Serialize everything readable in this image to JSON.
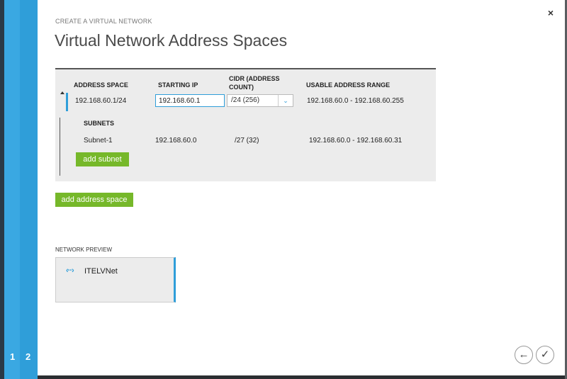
{
  "wizard": {
    "steps": [
      "1",
      "2"
    ],
    "subtitle": "CREATE A VIRTUAL NETWORK",
    "title": "Virtual Network Address Spaces",
    "close": "×"
  },
  "address_table": {
    "headers": {
      "address_space": "ADDRESS SPACE",
      "starting_ip": "STARTING IP",
      "cidr_line1": "CIDR (ADDRESS",
      "cidr_line2": "COUNT)",
      "usable_range": "USABLE ADDRESS RANGE"
    },
    "row": {
      "address_space": "192.168.60.1/24",
      "starting_ip": "192.168.60.1",
      "cidr": "/24 (256)",
      "usable_range": "192.168.60.0 - 192.168.60.255"
    },
    "subnets_header": "SUBNETS",
    "subnet": {
      "name": "Subnet-1",
      "starting_ip": "192.168.60.0",
      "cidr": "/27 (32)",
      "usable_range": "192.168.60.0 - 192.168.60.31"
    },
    "add_subnet_label": "add subnet"
  },
  "add_address_space_label": "add address space",
  "network_preview": {
    "label": "NETWORK PREVIEW",
    "icon": "‹··›",
    "network_name": "ITELVNet"
  },
  "nav": {
    "back_glyph": "←",
    "finish_glyph": "✓"
  },
  "colors": {
    "accent_blue": "#2f9ed9",
    "button_green": "#76b82a"
  }
}
